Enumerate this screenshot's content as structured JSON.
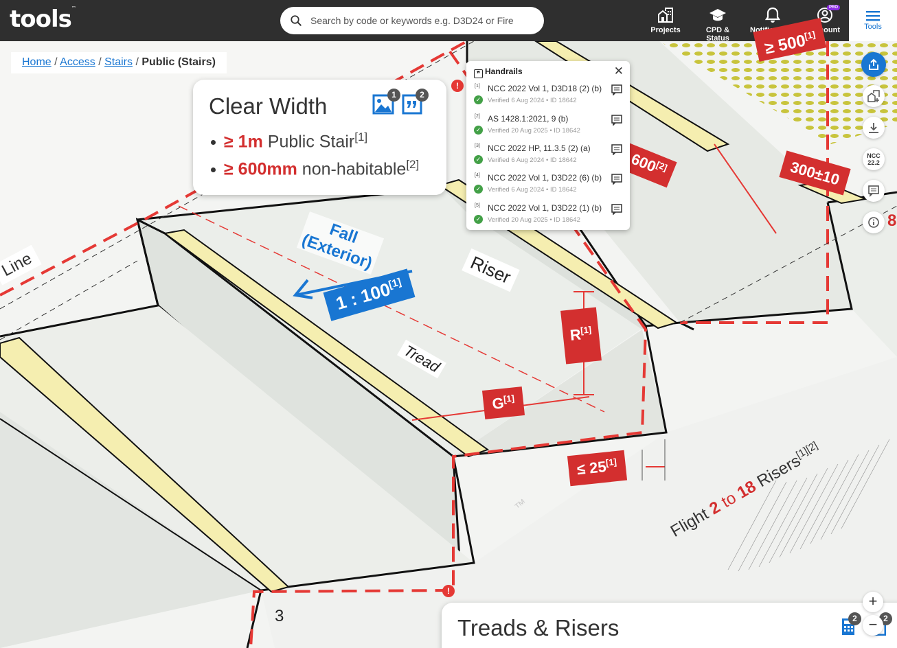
{
  "app": {
    "logo": "tools",
    "logo_mark": "™"
  },
  "search": {
    "placeholder": "Search by code or keywords e.g. D3D24 or Fire"
  },
  "nav": {
    "projects": "Projects",
    "cpd": "CPD & Status",
    "notifications": "Notifications",
    "account": "Account",
    "pro_badge": "PRO",
    "tools": "Tools"
  },
  "breadcrumb": {
    "home": "Home",
    "access": "Access",
    "stairs": "Stairs",
    "current": "Public (Stairs)",
    "sep": "/"
  },
  "clear_width": {
    "title": "Clear Width",
    "image_count": "1",
    "quote_count": "2",
    "items": [
      {
        "val": "≥ 1m",
        "text": "Public Stair",
        "ref": "[1]"
      },
      {
        "val": "≥ 600mm",
        "text": "non-habitable",
        "ref": "[2]"
      }
    ]
  },
  "handrails": {
    "title": "Handrails",
    "refs": [
      {
        "idx": "[1]",
        "code": "NCC 2022 Vol 1, D3D18 (2) (b)",
        "verified": "Verified 6 Aug 2024",
        "id": "ID 18642"
      },
      {
        "idx": "[2]",
        "code": "AS 1428.1:2021, 9 (b)",
        "verified": "Verified 20 Aug 2025",
        "id": "ID 18642"
      },
      {
        "idx": "[3]",
        "code": "NCC 2022 HP, 11.3.5 (2) (a)",
        "verified": "Verified 6 Aug 2024",
        "id": "ID 18642"
      },
      {
        "idx": "[4]",
        "code": "NCC 2022 Vol 1, D3D22 (6) (b)",
        "verified": "Verified 6 Aug 2024",
        "id": "ID 18642"
      },
      {
        "idx": "[5]",
        "code": "NCC 2022 Vol 1, D3D22 (1) (b)",
        "verified": "Verified 20 Aug 2025",
        "id": "ID 18642"
      }
    ]
  },
  "sidebar": {
    "ncc_line1": "NCC",
    "ncc_line2": "22.2"
  },
  "diagram": {
    "line_label": "Line",
    "fall": "Fall",
    "exterior": "(Exterior)",
    "gradient": "1 : 100",
    "gradient_ref": "[1]",
    "riser": "Riser",
    "tread": "Tread",
    "r_label": "R",
    "r_ref": "[1]",
    "g_label": "G",
    "g_ref": "[1]",
    "nosing": "≤ 25",
    "nosing_ref": "[1]",
    "flight_pre": "Flight",
    "flight_min": "2",
    "flight_to": "to",
    "flight_max": "18",
    "flight_post": "Risers",
    "flight_ref": "[1][2]",
    "dim_500": "≥ 500",
    "dim_500_ref": "[1]",
    "dim_600": "600",
    "dim_600_ref": "[2]",
    "dim_300": "300±10",
    "tm": "™",
    "step_number": "3",
    "edge_number": "8"
  },
  "treads_risers": {
    "title": "Treads & Risers",
    "badge_a": "2",
    "badge_b": "2"
  },
  "zoom": {
    "in": "+",
    "out": "−"
  },
  "warn": "!",
  "colors": {
    "topbar": "#2f2f2f",
    "accent": "#1976d2",
    "alert_red": "#d32f2f",
    "nosing_yellow": "#f5eeb0",
    "verified_green": "#43a047"
  }
}
